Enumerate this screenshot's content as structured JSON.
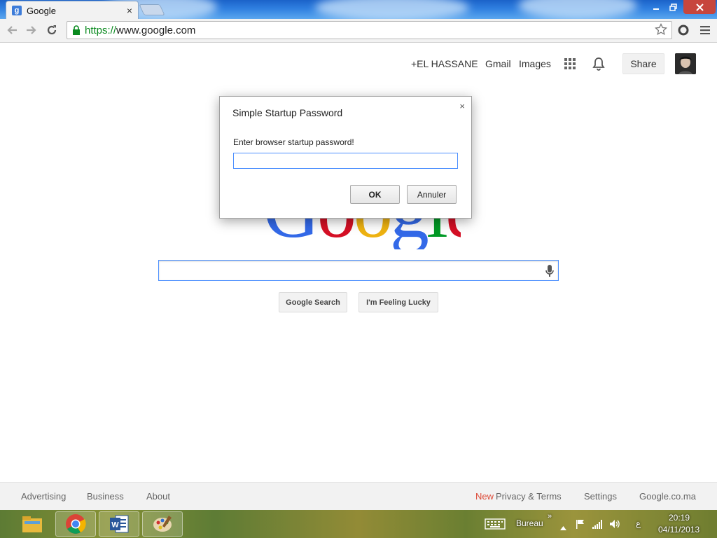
{
  "browser": {
    "tab_title": "Google",
    "tab_favicon": "g",
    "tab_close": "×",
    "url_scheme": "https://",
    "url_rest": "www.google.com"
  },
  "topbar": {
    "user_name": "+EL HASSANE",
    "gmail": "Gmail",
    "images": "Images",
    "share": "Share"
  },
  "logo": [
    "G",
    "o",
    "o",
    "g",
    "l",
    "e"
  ],
  "logo_colors": [
    "#3369e8",
    "#d50f25",
    "#eeb211",
    "#3369e8",
    "#009925",
    "#d50f25"
  ],
  "search": {
    "google_search": "Google Search",
    "feeling_lucky": "I'm Feeling Lucky"
  },
  "dialog": {
    "title": "Simple Startup Password",
    "message": "Enter browser startup password!",
    "input_value": "",
    "ok": "OK",
    "cancel": "Annuler",
    "close": "×"
  },
  "footer": {
    "advertising": "Advertising",
    "business": "Business",
    "about": "About",
    "new_label": "New",
    "privacy_terms": "Privacy & Terms",
    "settings": "Settings",
    "google_ma": "Google.co.ma"
  },
  "taskbar": {
    "apps": [
      "file-explorer-icon",
      "chrome-icon",
      "word-icon",
      "paint-icon"
    ],
    "toolbar_label": "Bureau",
    "toolbar_chevron": "»",
    "language": "ع",
    "time": "20:19",
    "date": "04/11/2013"
  },
  "colors": {
    "accent_blue": "#4d90fe",
    "link_gray": "#666666",
    "new_red": "#dd4b39",
    "https_green": "#0a8a1f"
  }
}
